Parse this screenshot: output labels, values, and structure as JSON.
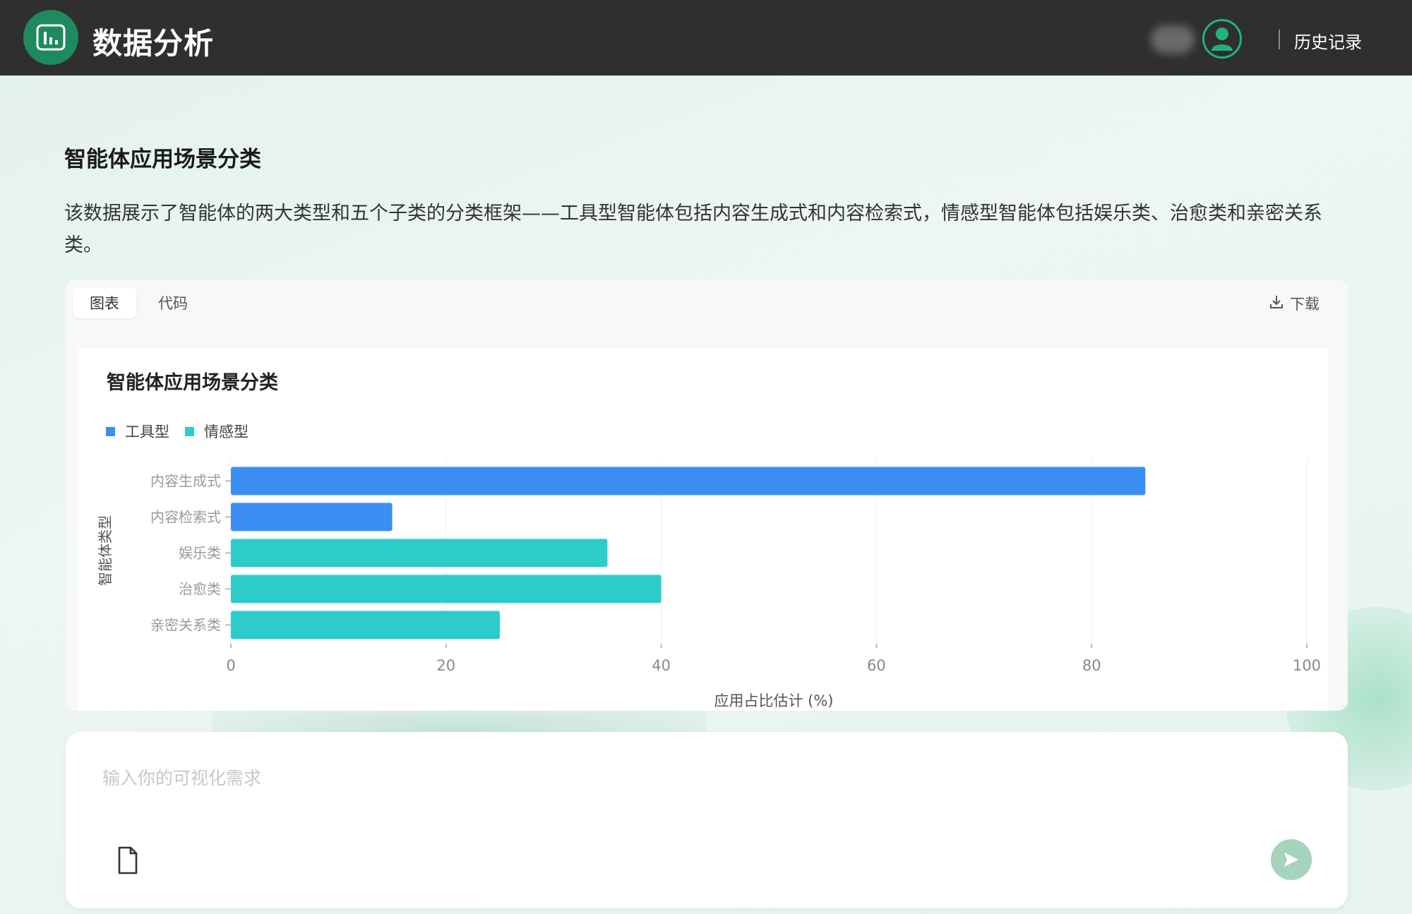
{
  "header": {
    "app_title": "数据分析",
    "history_label": "历史记录"
  },
  "section": {
    "title": "智能体应用场景分类",
    "description": "该数据展示了智能体的两大类型和五个子类的分类框架——工具型智能体包括内容生成式和内容检索式，情感型智能体包括娱乐类、治愈类和亲密关系类。"
  },
  "chart_card": {
    "tabs": [
      {
        "label": "图表"
      },
      {
        "label": "代码"
      }
    ],
    "download_label": "下载"
  },
  "chart_data": {
    "type": "bar",
    "orientation": "horizontal",
    "title": "智能体应用场景分类",
    "categories": [
      "内容生成式",
      "内容检索式",
      "娱乐类",
      "治愈类",
      "亲密关系类"
    ],
    "values": [
      85,
      15,
      35,
      40,
      25
    ],
    "category_type": [
      "工具型",
      "工具型",
      "情感型",
      "情感型",
      "情感型"
    ],
    "legend": [
      {
        "name": "工具型",
        "color": "#3b8ff2"
      },
      {
        "name": "情感型",
        "color": "#2ecbcb"
      }
    ],
    "legend_position": "top-left",
    "xlabel": "应用占比估计 (%)",
    "ylabel": "智能体类型",
    "xlim": [
      0,
      100
    ],
    "xticks": [
      0,
      20,
      40,
      60,
      80,
      100
    ],
    "grid": true
  },
  "input": {
    "placeholder": "输入你的可视化需求",
    "value": ""
  },
  "icons": {
    "logo": "bar-chart-icon",
    "avatar": "user-icon",
    "download": "download-icon",
    "attach": "file-icon",
    "send": "send-icon"
  }
}
